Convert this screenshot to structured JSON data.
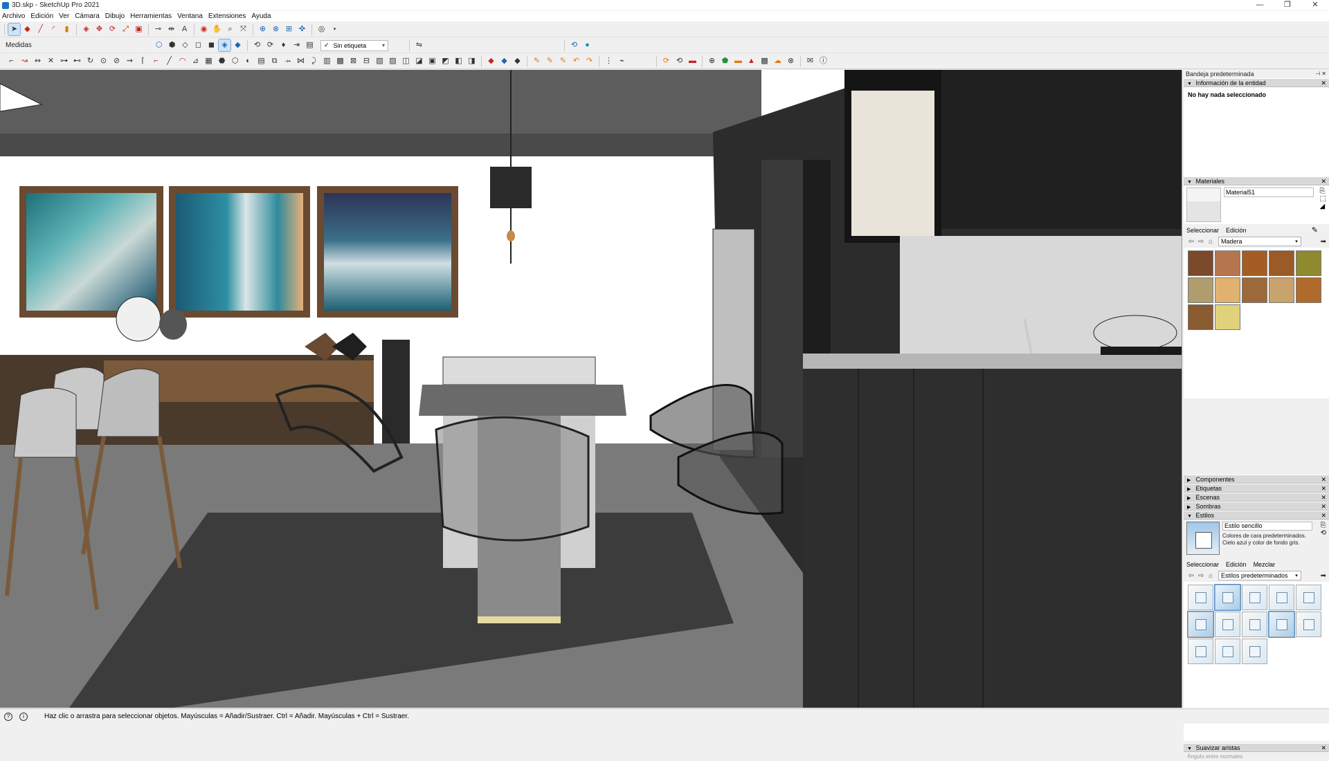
{
  "window": {
    "title": "3D.skp - SketchUp Pro 2021",
    "minimize": "—",
    "restore": "❐",
    "close": "✕"
  },
  "menu": [
    "Archivo",
    "Edición",
    "Ver",
    "Cámara",
    "Dibujo",
    "Herramientas",
    "Ventana",
    "Extensiones",
    "Ayuda"
  ],
  "toolbar": {
    "measurements_label": "Medidas",
    "tag_selector": "Sin etiqueta",
    "tag_check": "✓"
  },
  "tray": {
    "title": "Bandeja predeterminada",
    "entity_info": {
      "title": "Información de la entidad",
      "message": "No hay nada seleccionado"
    },
    "materials": {
      "title": "Materiales",
      "current_name": "Material51",
      "tabs": [
        "Seleccionar",
        "Edición"
      ],
      "collection": "Madera",
      "swatch_colors": [
        "#7a4a2a",
        "#b5764f",
        "#a45e23",
        "#9c5a27",
        "#8f8a2e",
        "#b09d6e",
        "#e1b170",
        "#9c6a3a",
        "#c9a36e",
        "#b06a2b",
        "#8a5a30",
        "#e0d27a"
      ]
    },
    "collapsed_panels": [
      "Componentes",
      "Etiquetas",
      "Escenas",
      "Sombras"
    ],
    "styles": {
      "title": "Estilos",
      "current_name": "Estilo sencillo",
      "description": "Colores de cara predeterminados. Cielo azul y color de fondo gris.",
      "tabs": [
        "Seleccionar",
        "Edición",
        "Mezclar"
      ],
      "collection": "Estilos predeterminados"
    },
    "soften": {
      "title": "Suavizar aristas",
      "hint": "Ángulo entre normales"
    }
  },
  "status": {
    "hint": "Haz clic o arrastra para seleccionar objetos. Mayúsculas = Añadir/Sustraer. Ctrl = Añadir. Mayúsculas + Ctrl = Sustraer."
  }
}
